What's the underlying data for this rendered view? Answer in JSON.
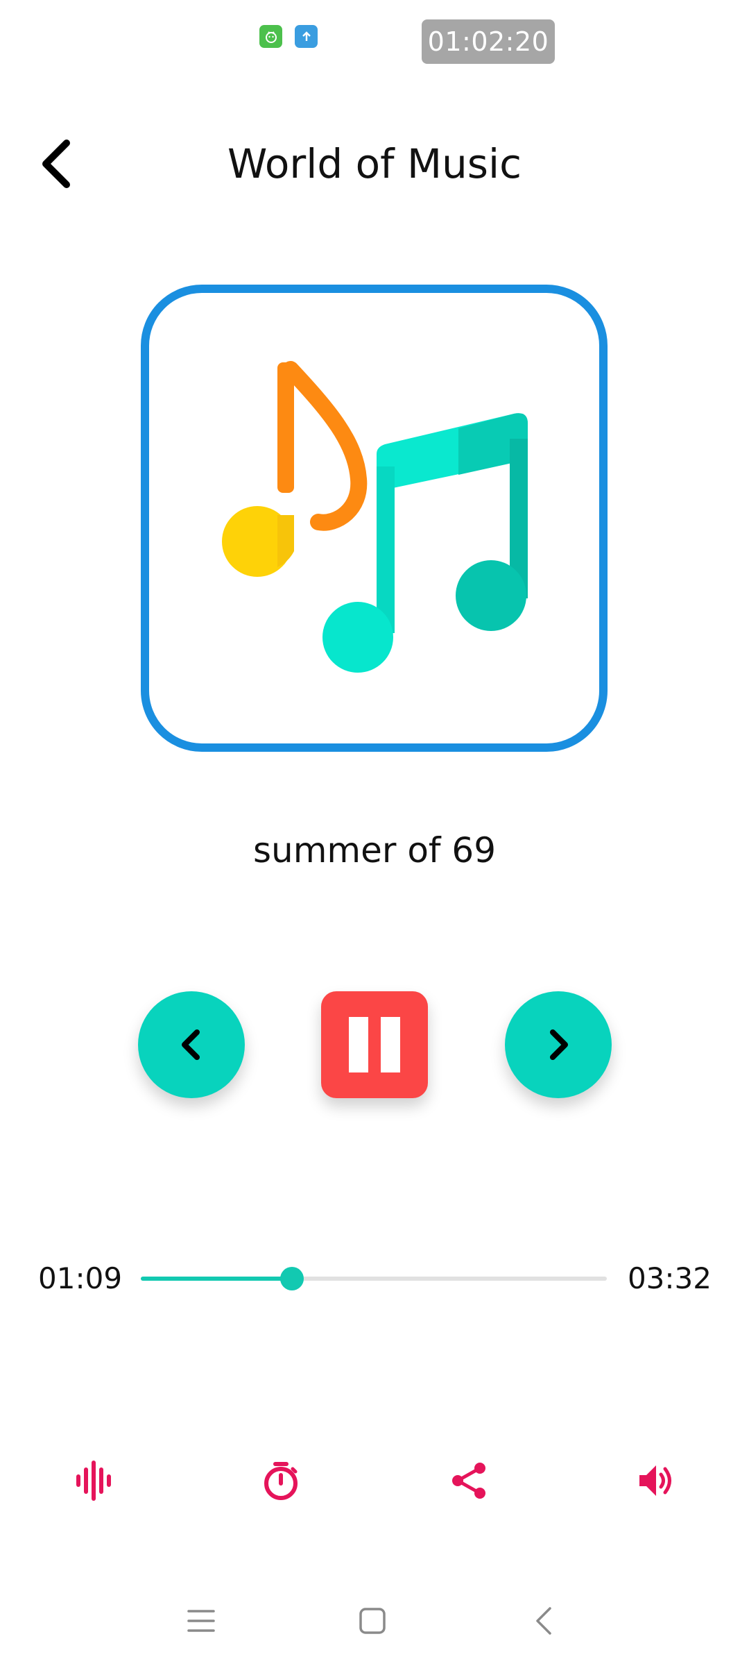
{
  "status_bar": {
    "clock": "01:02:20",
    "icons": [
      "android-app-icon",
      "upload-app-icon"
    ]
  },
  "header": {
    "title": "World of Music",
    "back_icon": "back-arrow-icon"
  },
  "album_art": {
    "icon": "music-notes-icon",
    "border_color": "#1a8fe0"
  },
  "track": {
    "title": "summer of 69",
    "elapsed": "01:09",
    "duration": "03:32",
    "progress": 0.325
  },
  "controls": {
    "previous_icon": "chevron-left-icon",
    "pause_icon": "pause-icon",
    "next_icon": "chevron-right-icon",
    "round_color": "#08d3bd",
    "pause_color": "#fb4646"
  },
  "actions": [
    {
      "icon": "equalizer-icon"
    },
    {
      "icon": "timer-icon"
    },
    {
      "icon": "share-icon"
    },
    {
      "icon": "volume-icon"
    }
  ],
  "colors": {
    "accent": "#12c9b1",
    "action_icons": "#e5145a"
  },
  "system_nav": [
    "menu-icon",
    "home-icon",
    "back-icon"
  ]
}
